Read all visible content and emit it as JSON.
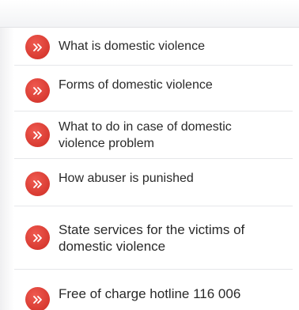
{
  "menu": {
    "items": [
      {
        "label": "What is domestic violence",
        "icon": "double-chevron-right-icon"
      },
      {
        "label": "Forms of domestic violence",
        "icon": "double-chevron-right-icon"
      },
      {
        "label": "What to do in case of domestic violence problem",
        "icon": "double-chevron-right-icon"
      },
      {
        "label": "How abuser is punished",
        "icon": "double-chevron-right-icon"
      },
      {
        "label": "State services for the victims of domestic violence",
        "icon": "double-chevron-right-icon"
      },
      {
        "label": "Free of charge hotline 116 006",
        "icon": "double-chevron-right-icon"
      }
    ]
  },
  "colors": {
    "badge": "#e0443a",
    "text": "#2a2a2a",
    "divider": "#e6e7ea"
  }
}
